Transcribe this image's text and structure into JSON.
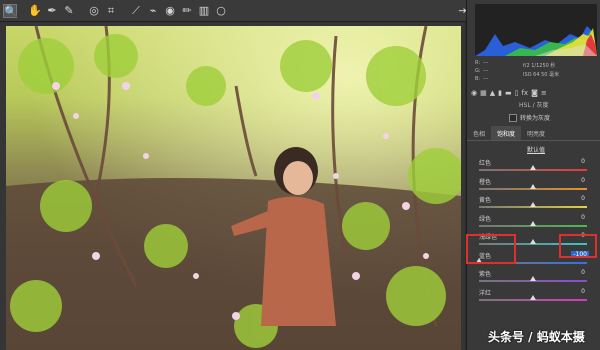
{
  "toolbar": {
    "tools": [
      {
        "name": "zoom-tool",
        "glyph": "🔍"
      },
      {
        "name": "hand-tool",
        "glyph": "✋"
      },
      {
        "name": "white-balance-tool",
        "glyph": "✒"
      },
      {
        "name": "color-sampler-tool",
        "glyph": "✎"
      },
      {
        "name": "targeted-adjustment-tool",
        "glyph": "◎"
      },
      {
        "name": "crop-tool",
        "glyph": "⌗"
      },
      {
        "name": "straighten-tool",
        "glyph": "⟋"
      },
      {
        "name": "spot-removal-tool",
        "glyph": "⌁"
      },
      {
        "name": "red-eye-tool",
        "glyph": "◉"
      },
      {
        "name": "adjustment-brush-tool",
        "glyph": "✏"
      },
      {
        "name": "graduated-filter-tool",
        "glyph": "▥"
      },
      {
        "name": "radial-filter-tool",
        "glyph": "○"
      }
    ],
    "right_icon": "⇥"
  },
  "info": {
    "rgb_labels": [
      "R:",
      "G:",
      "B:"
    ],
    "rgb_values": [
      "---",
      "---",
      "---"
    ],
    "exposure": "f/2   1/1250 秒",
    "iso": "ISO 64   50 毫米"
  },
  "panel": {
    "section_title": "HSL / 灰度",
    "checkbox_label": "转换为灰度",
    "tabs": [
      "色相",
      "饱和度",
      "明亮度"
    ],
    "default_link": "默认值",
    "sliders": [
      {
        "label": "红色",
        "value": "0",
        "pos": 0.5,
        "color": "#e23b3b"
      },
      {
        "label": "橙色",
        "value": "0",
        "pos": 0.5,
        "color": "#e8902c"
      },
      {
        "label": "黄色",
        "value": "0",
        "pos": 0.5,
        "color": "#e0d23a"
      },
      {
        "label": "绿色",
        "value": "0",
        "pos": 0.5,
        "color": "#4cb84c"
      },
      {
        "label": "浅绿色",
        "value": "0",
        "pos": 0.5,
        "color": "#3ac6c6"
      },
      {
        "label": "蓝色",
        "value": "-100",
        "pos": 0.0,
        "color": "#3a6ee0"
      },
      {
        "label": "紫色",
        "value": "0",
        "pos": 0.5,
        "color": "#8a4ad0"
      },
      {
        "label": "洋红",
        "value": "0",
        "pos": 0.5,
        "color": "#d23ac2"
      }
    ]
  },
  "watermark": "头条号 / 蚂蚁本摄"
}
